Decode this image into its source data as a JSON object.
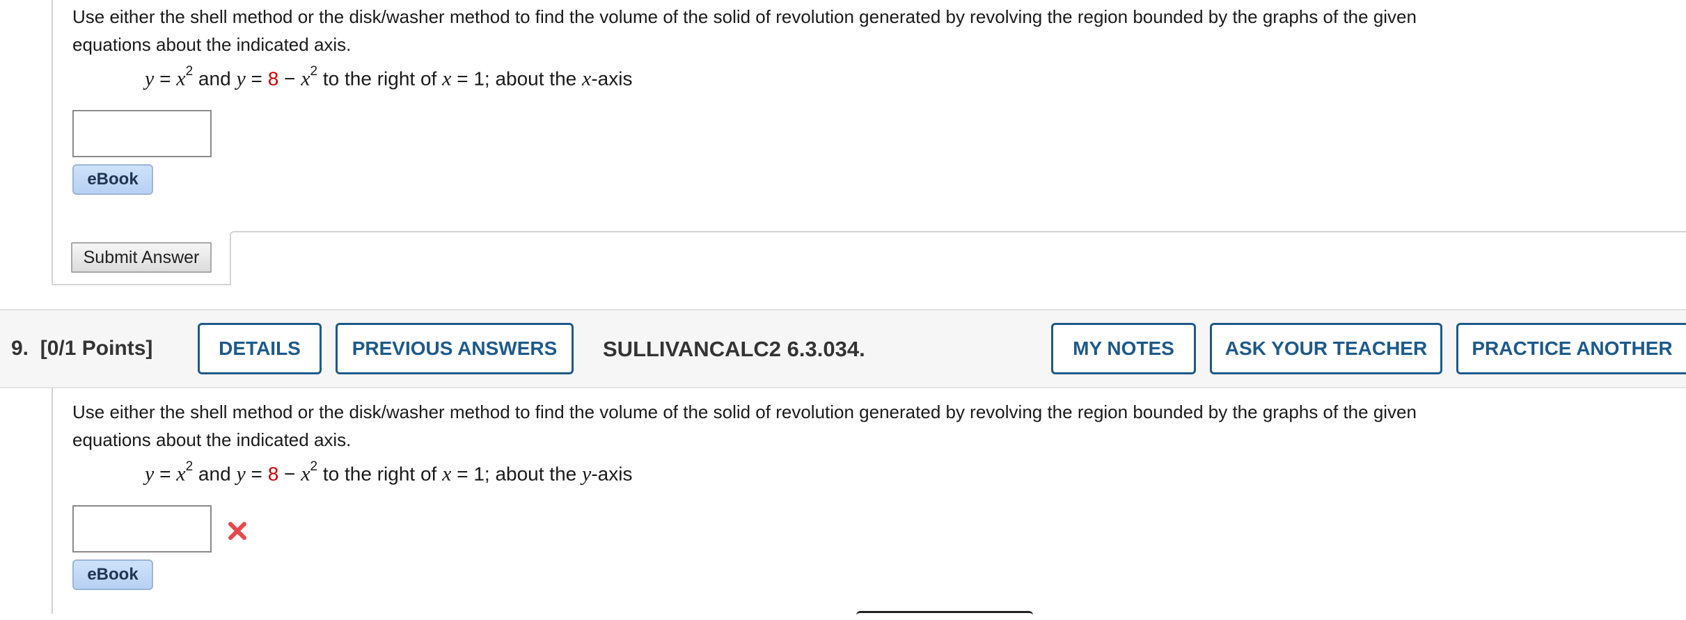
{
  "question8": {
    "prompt_line1": "Use either the shell method or the disk/washer method to find the volume of the solid of revolution generated by revolving the region bounded by the graphs of the given",
    "prompt_line2": "equations about the indicated axis.",
    "equation": {
      "y1": "y",
      "eq1": " = ",
      "x1": "x",
      "exp1": "2",
      "and": " and ",
      "y2": "y",
      "eq2": " = ",
      "const": "8",
      "minus": " − ",
      "x2": "x",
      "exp2": "2",
      "right_of": " to the right of ",
      "x3": "x",
      "eq3": " = 1; about the ",
      "axis_var": "x",
      "axis_suffix": "-axis"
    },
    "answer_value": "",
    "ebook_label": "eBook",
    "submit_label": "Submit Answer"
  },
  "question9": {
    "number": "9.",
    "points": "[0/1 Points]",
    "buttons": {
      "details": "DETAILS",
      "previous_answers": "PREVIOUS ANSWERS",
      "my_notes": "MY NOTES",
      "ask_teacher": "ASK YOUR TEACHER",
      "practice_another": "PRACTICE ANOTHER"
    },
    "code": "SULLIVANCALC2 6.3.034.",
    "prompt_line1": "Use either the shell method or the disk/washer method to find the volume of the solid of revolution generated by revolving the region bounded by the graphs of the given",
    "prompt_line2": "equations about the indicated axis.",
    "equation": {
      "y1": "y",
      "eq1": " = ",
      "x1": "x",
      "exp1": "2",
      "and": " and ",
      "y2": "y",
      "eq2": " = ",
      "const": "8",
      "minus": " − ",
      "x2": "x",
      "exp2": "2",
      "right_of": " to the right of ",
      "x3": "x",
      "eq3": " = 1; about the ",
      "axis_var": "y",
      "axis_suffix": "-axis"
    },
    "answer_value": "",
    "status_icon": "incorrect-x-icon",
    "ebook_label": "eBook"
  },
  "colors": {
    "accent": "#1d5a8a",
    "constant_red": "#cc0000",
    "incorrect_red": "#e8484a"
  }
}
